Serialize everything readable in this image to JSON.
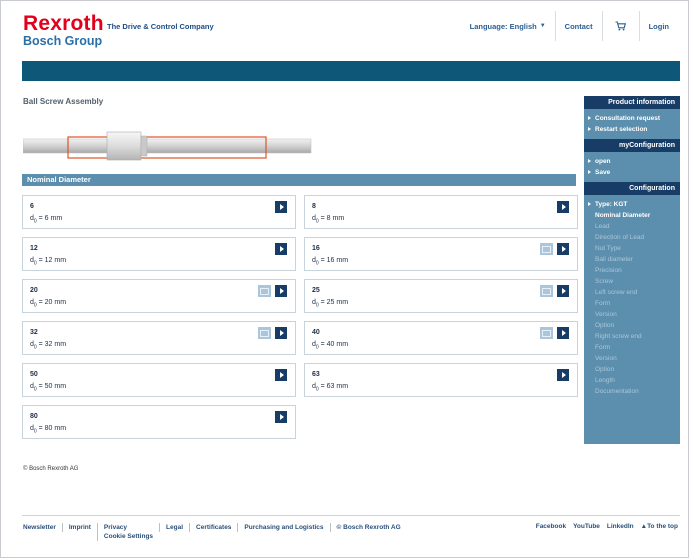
{
  "header": {
    "logo_main": "Rexroth",
    "logo_sub": "Bosch Group",
    "tagline": "The Drive & Control Company",
    "language_label": "Language: English",
    "contact": "Contact",
    "login": "Login"
  },
  "page": {
    "title": "Ball Screw Assembly",
    "section_title": "Nominal Diameter",
    "copyright": "© Bosch Rexroth AG"
  },
  "cards": [
    {
      "value": "6",
      "sub_prefix": "d",
      "sub_index": "0",
      "sub_text": " = 6 mm"
    },
    {
      "value": "8",
      "sub_prefix": "d",
      "sub_index": "0",
      "sub_text": " = 8 mm"
    },
    {
      "value": "12",
      "sub_prefix": "d",
      "sub_index": "0",
      "sub_text": " = 12 mm"
    },
    {
      "value": "16",
      "sub_prefix": "d",
      "sub_index": "0",
      "sub_text": " = 16 mm"
    },
    {
      "value": "20",
      "sub_prefix": "d",
      "sub_index": "0",
      "sub_text": " = 20 mm"
    },
    {
      "value": "25",
      "sub_prefix": "d",
      "sub_index": "0",
      "sub_text": " = 25 mm"
    },
    {
      "value": "32",
      "sub_prefix": "d",
      "sub_index": "0",
      "sub_text": " = 32 mm"
    },
    {
      "value": "40",
      "sub_prefix": "d",
      "sub_index": "0",
      "sub_text": " = 40 mm"
    },
    {
      "value": "50",
      "sub_prefix": "d",
      "sub_index": "0",
      "sub_text": " = 50 mm"
    },
    {
      "value": "63",
      "sub_prefix": "d",
      "sub_index": "0",
      "sub_text": " = 63 mm"
    },
    {
      "value": "80",
      "sub_prefix": "d",
      "sub_index": "0",
      "sub_text": " = 80 mm"
    }
  ],
  "sidebar": {
    "product_info_title": "Product information",
    "product_info_items": [
      "Consultation request",
      "Restart selection"
    ],
    "myconfig_title": "myConfiguration",
    "myconfig_items": [
      "open",
      "Save"
    ],
    "config_title": "Configuration",
    "config_items": [
      {
        "label": "Type: KGT",
        "state": "active"
      },
      {
        "label": "Nominal Diameter",
        "state": "current"
      },
      {
        "label": "Lead",
        "state": "dim"
      },
      {
        "label": "Direction of Lead",
        "state": "dim"
      },
      {
        "label": "Nut Type",
        "state": "dim"
      },
      {
        "label": "Ball diameter",
        "state": "dim"
      },
      {
        "label": "Precision",
        "state": "dim"
      },
      {
        "label": "Screw",
        "state": "dim"
      },
      {
        "label": "Left screw end",
        "state": "dim"
      },
      {
        "label": "Form",
        "state": "dim"
      },
      {
        "label": "Version",
        "state": "dim"
      },
      {
        "label": "Option",
        "state": "dim"
      },
      {
        "label": "Right screw end",
        "state": "dim"
      },
      {
        "label": "Form",
        "state": "dim"
      },
      {
        "label": "Version",
        "state": "dim"
      },
      {
        "label": "Option",
        "state": "dim"
      },
      {
        "label": "Length",
        "state": "dim"
      },
      {
        "label": "Documentation",
        "state": "dim"
      }
    ]
  },
  "footer": {
    "links": [
      "Newsletter",
      "Imprint",
      "Privacy",
      "Cookie Settings",
      "Legal",
      "Certificates",
      "Purchasing and Logistics",
      "© Bosch Rexroth AG"
    ],
    "social": [
      "Facebook",
      "YouTube",
      "LinkedIn",
      "▲To the top"
    ]
  },
  "colors": {
    "brand_red": "#e2001a",
    "banner": "#0f5779",
    "sidebar_bg": "#5c8fad",
    "sidebar_head": "#173c66",
    "button": "#173c66",
    "config_button": "#a9c6dd"
  },
  "icons": {
    "cart": "cart-icon",
    "go": "arrow-right-icon",
    "configure": "configure-icon"
  }
}
